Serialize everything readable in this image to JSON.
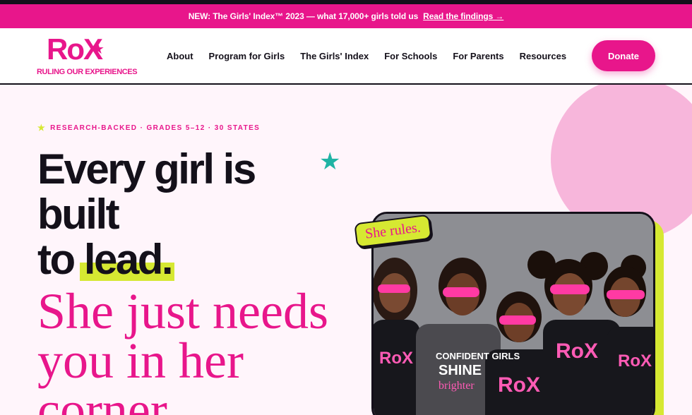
{
  "announcement": {
    "text": "NEW: The Girls' Index™ 2023 — what 17,000+ girls told us",
    "link": "Read the findings →"
  },
  "logo": {
    "mark": "RoX",
    "tagline": "RULING OUR EXPERIENCES"
  },
  "nav": {
    "items": [
      {
        "label": "About"
      },
      {
        "label": "Program for Girls"
      },
      {
        "label": "The Girls' Index"
      },
      {
        "label": "For Schools"
      },
      {
        "label": "For Parents"
      },
      {
        "label": "Resources"
      }
    ],
    "donate_label": "Donate"
  },
  "hero": {
    "eyebrow": "RESEARCH-BACKED · GRADES 5–12 · 30 STATES",
    "headline_line1": "Every girl is",
    "headline_line2": "built",
    "headline_to": "to",
    "headline_highlight": "lead.",
    "subhead": "She just needs you in her corner.",
    "sticker": "She rules."
  },
  "colors": {
    "brand_pink": "#e8168b",
    "accent_lime": "#d6e832",
    "accent_teal": "#1fb3a4",
    "ink": "#14101a",
    "background": "#fff5fb"
  },
  "icons": {
    "eyebrow": "star-icon",
    "decor": "teal-star-icon",
    "logo": "star-icon"
  }
}
